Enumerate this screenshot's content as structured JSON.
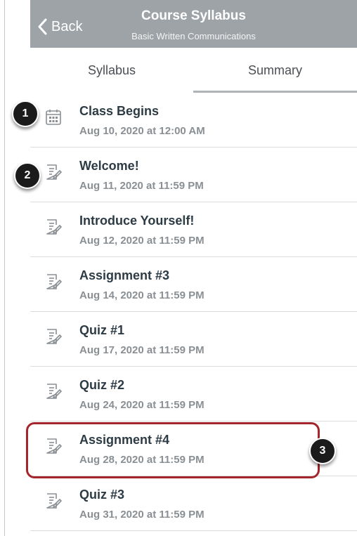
{
  "navbar": {
    "back_label": "Back",
    "title": "Course Syllabus",
    "subtitle": "Basic Written Communications"
  },
  "tabs": [
    {
      "label": "Syllabus",
      "selected": false
    },
    {
      "label": "Summary",
      "selected": true
    }
  ],
  "items": [
    {
      "title": "Class Begins",
      "date": "Aug 10, 2020 at 12:00 AM",
      "icon": "calendar-icon"
    },
    {
      "title": "Welcome!",
      "date": "Aug 11, 2020 at 11:59 PM",
      "icon": "assignment-icon"
    },
    {
      "title": "Introduce Yourself!",
      "date": "Aug 12, 2020 at 11:59 PM",
      "icon": "assignment-icon"
    },
    {
      "title": "Assignment #3",
      "date": "Aug 14, 2020 at 11:59 PM",
      "icon": "assignment-icon"
    },
    {
      "title": "Quiz #1",
      "date": "Aug 17, 2020 at 11:59 PM",
      "icon": "assignment-icon"
    },
    {
      "title": "Quiz #2",
      "date": "Aug 24, 2020 at 11:59 PM",
      "icon": "assignment-icon"
    },
    {
      "title": "Assignment #4",
      "date": "Aug 28, 2020 at 11:59 PM",
      "icon": "assignment-icon"
    },
    {
      "title": "Quiz #3",
      "date": "Aug 31, 2020 at 11:59 PM",
      "icon": "assignment-icon"
    }
  ],
  "callouts": [
    "1",
    "2",
    "3"
  ],
  "colors": {
    "navbar": "#9ea3a8",
    "highlight": "#a4262c",
    "title_text": "#2d3b45",
    "date_text": "#8a8f94"
  }
}
